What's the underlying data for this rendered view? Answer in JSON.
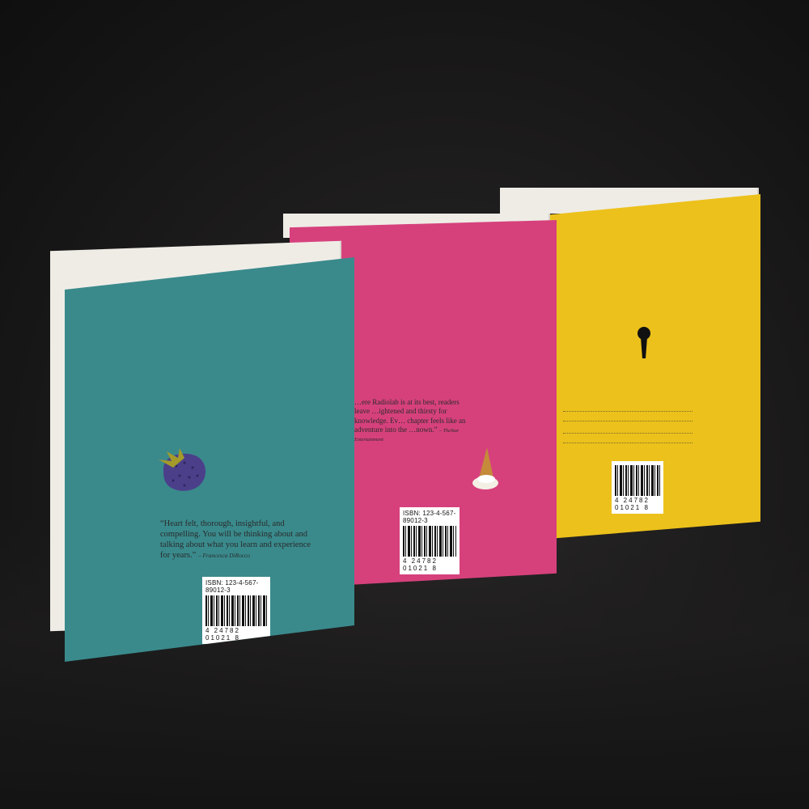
{
  "colors": {
    "teal_cover": "#3a8a8c",
    "pink_cover": "#d6417c",
    "yellow_cover": "#ecc11b",
    "background": "#1b1a1a"
  },
  "books": {
    "teal": {
      "quote": "“Heart felt, thorough, insightful, and compelling. You will be thinking about and talking about what you learn and experience for years.”",
      "attribution": "– Francesca DiRocco",
      "isbn": "ISBN: 123-4-567-89012-3",
      "barcode_number": "4 24782 01021 8",
      "icon": "strawberry-icon"
    },
    "pink": {
      "quote": "…ere Radiolab is at its best, readers leave …ightened and thirsty for knowledge. Ev… chapter feels like an adventure into the …nown.”",
      "attribution": "– TheStar Entertainment",
      "isbn": "ISBN: 123-4-567-89012-3",
      "barcode_number": "4 24782 01021 8",
      "icon": "ice-cream-cone-icon"
    },
    "yellow": {
      "icon": "keyhole-icon",
      "barcode_number": "4 24782 01021 8"
    }
  }
}
